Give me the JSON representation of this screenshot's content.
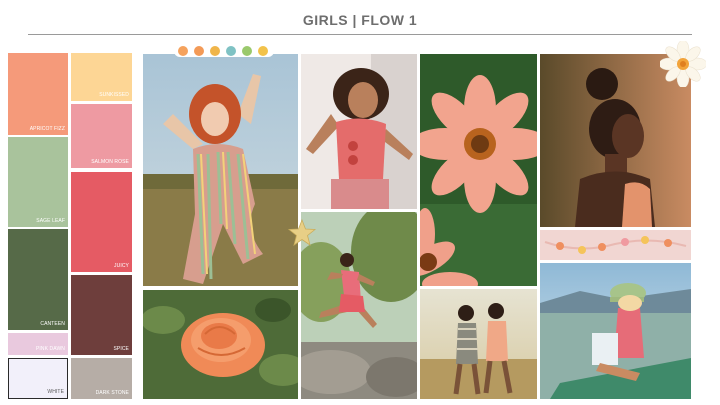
{
  "page": {
    "title": "GIRLS | FLOW 1"
  },
  "palette": [
    {
      "name": "APRICOT FIZZ",
      "color": "#F59A7A"
    },
    {
      "name": "SAGE LEAF",
      "color": "#A9C39C"
    },
    {
      "name": "CANTEEN",
      "color": "#566A48"
    },
    {
      "name": "PINK DAWN",
      "color": "#E9C9DE"
    },
    {
      "name": "WHITE",
      "color": "#F2F0FA"
    },
    {
      "name": "SUNKISSED",
      "color": "#FDD695"
    },
    {
      "name": "SALMON ROSE",
      "color": "#EE9AA2"
    },
    {
      "name": "JUICY",
      "color": "#E55B64"
    },
    {
      "name": "SPICE",
      "color": "#6E3E3C"
    },
    {
      "name": "DARK STONE",
      "color": "#B6ADA6"
    }
  ]
}
